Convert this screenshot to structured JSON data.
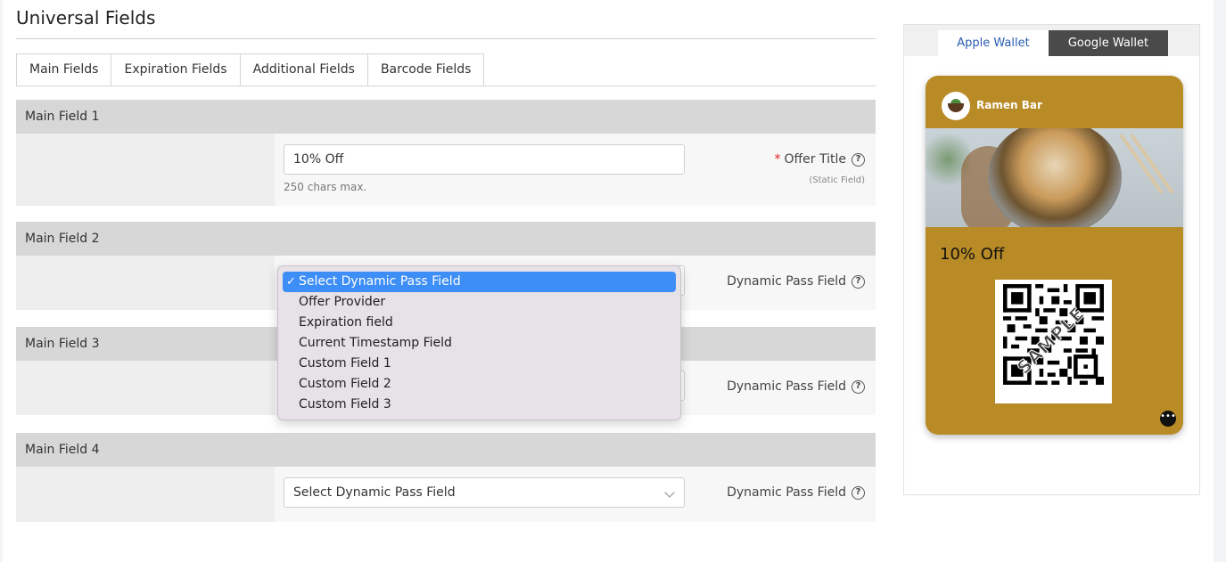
{
  "page": {
    "title": "Universal Fields"
  },
  "tabs": [
    {
      "label": "Main Fields",
      "active": true
    },
    {
      "label": "Expiration Fields",
      "active": false
    },
    {
      "label": "Additional Fields",
      "active": false
    },
    {
      "label": "Barcode Fields",
      "active": false
    }
  ],
  "sections": [
    {
      "heading": "Main Field 1",
      "label": "Offer Title",
      "required": true,
      "sub_label": "(Static Field)",
      "value": "10% Off",
      "hint": "250 chars max."
    },
    {
      "heading": "Main Field 2",
      "label": "Dynamic Pass Field"
    },
    {
      "heading": "Main Field 3",
      "label": "Dynamic Pass Field"
    },
    {
      "heading": "Main Field 4",
      "label": "Dynamic Pass Field",
      "value": "Select Dynamic Pass Field"
    }
  ],
  "dropdown": {
    "options": [
      "Select Dynamic Pass Field",
      "Offer Provider",
      "Expiration field",
      "Current Timestamp Field",
      "Custom Field 1",
      "Custom Field 2",
      "Custom Field 3"
    ],
    "selected": "Select Dynamic Pass Field"
  },
  "preview": {
    "tabs": {
      "apple": "Apple Wallet",
      "google": "Google Wallet"
    },
    "active_tab": "Google Wallet",
    "card": {
      "brand_name": "Ramen Bar",
      "offer_text": "10% Off",
      "qr_watermark": "SAMPLE",
      "background_color": "#b98b26"
    }
  },
  "icons": {
    "help": "question-circle-icon",
    "chevron": "chevron-down-icon",
    "more": "more-dots-icon",
    "check": "checkmark-icon"
  }
}
